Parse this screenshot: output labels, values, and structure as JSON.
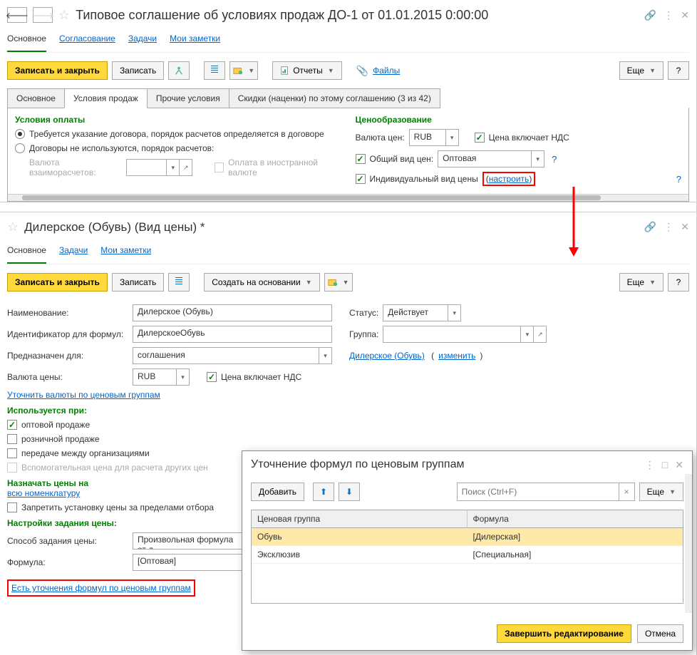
{
  "window1": {
    "title": "Типовое соглашение об условиях продаж ДО-1 от 01.01.2015 0:00:00",
    "nav": {
      "main": "Основное",
      "approval": "Согласование",
      "tasks": "Задачи",
      "notes": "Мои заметки"
    },
    "toolbar": {
      "save_close": "Записать и закрыть",
      "save": "Записать",
      "reports": "Отчеты",
      "files": "Файлы",
      "more": "Еще"
    },
    "tabs": {
      "main": "Основное",
      "sales": "Условия продаж",
      "other": "Прочие условия",
      "discounts": "Скидки (наценки) по этому соглашению (3 из 42)"
    },
    "payment": {
      "header": "Условия оплаты",
      "r1": "Требуется указание договора, порядок расчетов определяется в договоре",
      "r2": "Договоры не используются, порядок расчетов:",
      "currency_lbl": "Валюта взаиморасчетов:",
      "foreign": "Оплата в иностранной валюте"
    },
    "pricing": {
      "header": "Ценообразование",
      "currency_lbl": "Валюта цен:",
      "currency": "RUB",
      "vat": "Цена включает НДС",
      "common_lbl": "Общий вид цен:",
      "common_val": "Оптовая",
      "individual_lbl": "Индивидуальный вид цены",
      "configure": "настроить"
    }
  },
  "window2": {
    "title": "Дилерское (Обувь) (Вид цены) *",
    "nav": {
      "main": "Основное",
      "tasks": "Задачи",
      "notes": "Мои заметки"
    },
    "toolbar": {
      "save_close": "Записать и закрыть",
      "save": "Записать",
      "create_based": "Создать на основании",
      "more": "Еще"
    },
    "fields": {
      "name_lbl": "Наименование:",
      "name": "Дилерское (Обувь)",
      "status_lbl": "Статус:",
      "status": "Действует",
      "id_lbl": "Идентификатор для формул:",
      "id": "ДилерскоеОбувь",
      "group_lbl": "Группа:",
      "group": "",
      "purpose_lbl": "Предназначен для:",
      "purpose": "соглашения",
      "agreement": "Дилерское (Обувь)",
      "change": "изменить",
      "currency_lbl": "Валюта цены:",
      "currency": "RUB",
      "vat": "Цена включает НДС"
    },
    "refine_link": "Уточнить валюты по ценовым группам",
    "used_for": {
      "header": "Используется при:",
      "wholesale": "оптовой продаже",
      "retail": "розничной продаже",
      "transfer": "передаче между организациями",
      "aux": "Вспомогательная цена для расчета других цен"
    },
    "assign": {
      "header": "Назначать цены на",
      "all": "всю номенклатуру",
      "prohibit": "Запретить установку цены за пределами отбора"
    },
    "price_settings": {
      "header": "Настройки задания цены:",
      "method_lbl": "Способ задания цены:",
      "method": "Произвольная формула от д",
      "formula_lbl": "Формула:",
      "formula": "[Оптовая]",
      "refine": "Есть уточнения формул по ценовым группам"
    }
  },
  "dialog": {
    "title": "Уточнение формул по ценовым группам",
    "add": "Добавить",
    "search_ph": "Поиск (Ctrl+F)",
    "more": "Еще",
    "cols": {
      "group": "Ценовая группа",
      "formula": "Формула"
    },
    "rows": [
      {
        "group": "Обувь",
        "formula": "[Дилерская]"
      },
      {
        "group": "Эксклюзив",
        "formula": "[Специальная]"
      }
    ],
    "finish": "Завершить редактирование",
    "cancel": "Отмена"
  }
}
